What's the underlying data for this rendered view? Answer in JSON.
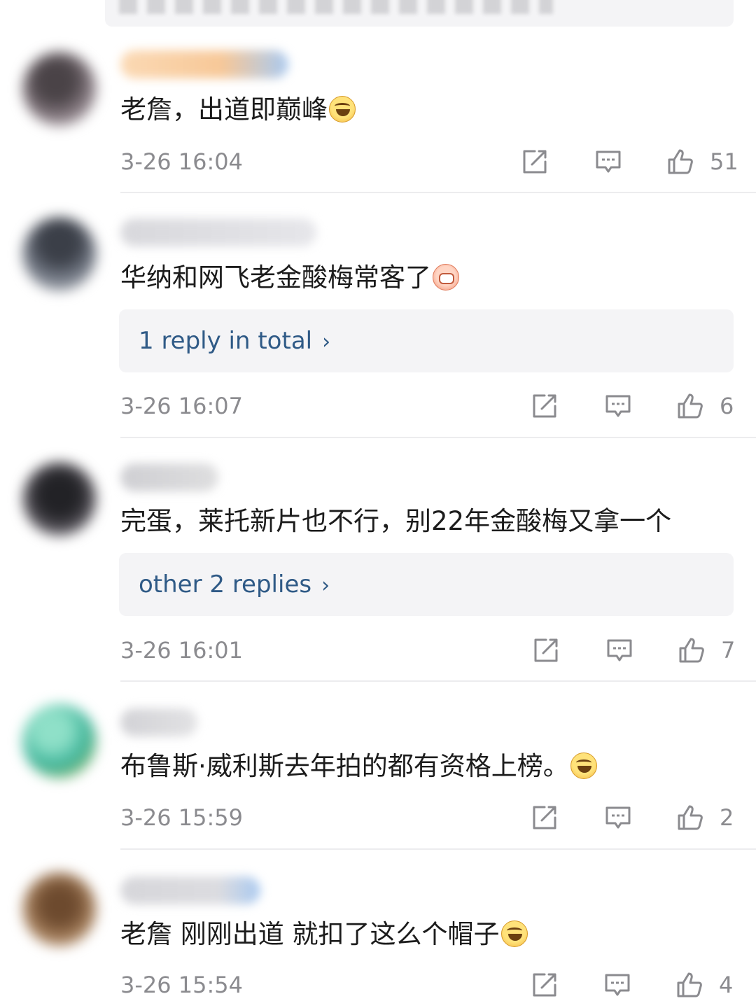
{
  "comments": [
    {
      "text": "老詹，出道即巅峰",
      "emoji": "laugh-cry-emoji",
      "time": "3-26 16:04",
      "likes": "51"
    },
    {
      "text": "华纳和网飞老金酸梅常客了",
      "emoji": "pig-emoji",
      "reply_link": "1 reply in total",
      "time": "3-26 16:07",
      "likes": "6"
    },
    {
      "text": "完蛋，莱托新片也不行，别22年金酸梅又拿一个",
      "reply_link": "other 2 replies",
      "time": "3-26 16:01",
      "likes": "7"
    },
    {
      "text": "布鲁斯·威利斯去年拍的都有资格上榜。",
      "emoji": "laugh-cry-emoji",
      "time": "3-26 15:59",
      "likes": "2"
    },
    {
      "text": "老詹 刚刚出道 就扣了这么个帽子",
      "emoji": "laugh-cry-emoji",
      "time": "3-26 15:54",
      "likes": "4"
    }
  ],
  "colors": {
    "text": "#1c1c1c",
    "meta": "#8b8b8f",
    "link": "#2f5a86",
    "reply_bg": "#f4f4f6"
  },
  "icons": [
    "share-icon",
    "comment-icon",
    "thumbs-up-icon",
    "chevron-right-icon"
  ]
}
